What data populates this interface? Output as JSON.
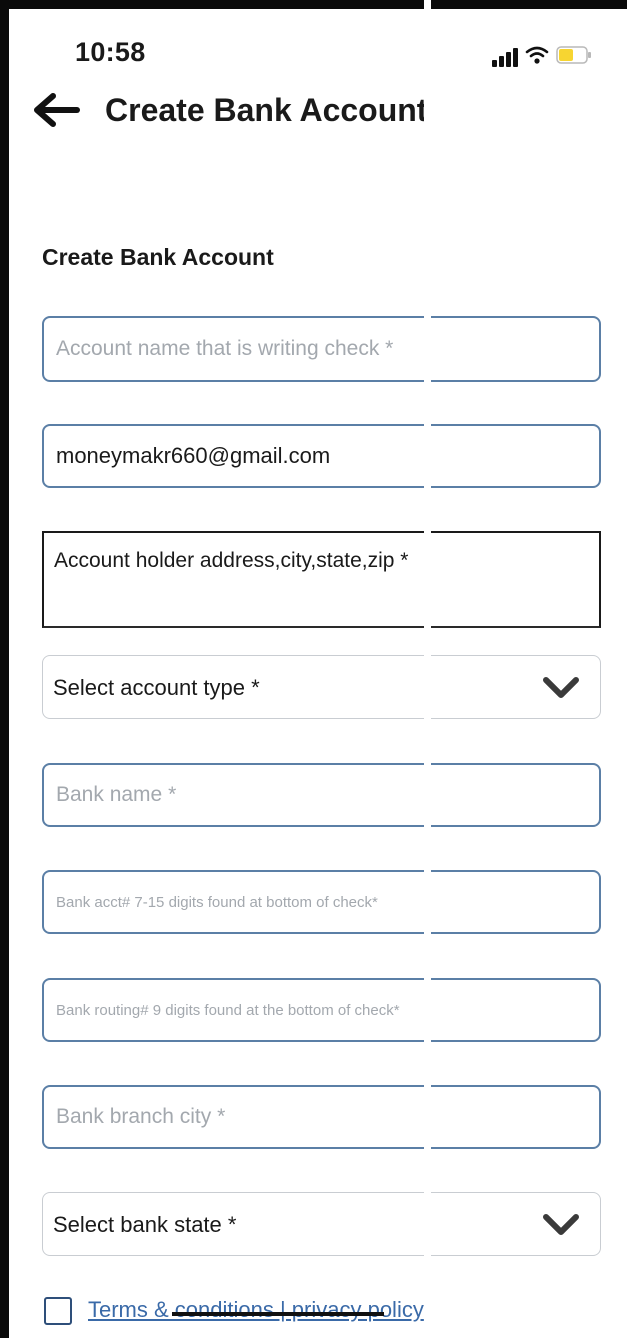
{
  "status_bar": {
    "time": "10:58",
    "icons": [
      "cellular-signal-icon",
      "wifi-icon",
      "battery-icon"
    ],
    "battery_color": "#f7d531"
  },
  "nav": {
    "back_icon": "arrow-left-icon",
    "title": "Create Bank Account"
  },
  "form": {
    "section_title": "Create Bank Account",
    "account_name": {
      "value": "",
      "placeholder": "Account name that is writing check *"
    },
    "email": {
      "value": "moneymakr660@gmail.com",
      "placeholder": ""
    },
    "address": {
      "value": "",
      "placeholder": "Account holder address,city,state,zip *"
    },
    "account_type": {
      "selected": "Select account type *",
      "icon": "chevron-down-icon"
    },
    "bank_name": {
      "value": "",
      "placeholder": "Bank name *"
    },
    "bank_account_number": {
      "value": "",
      "placeholder": "Bank acct# 7-15 digits found at bottom of check*"
    },
    "bank_routing_number": {
      "value": "",
      "placeholder": "Bank routing# 9 digits found at the bottom of check*"
    },
    "bank_branch_city": {
      "value": "",
      "placeholder": "Bank branch city *"
    },
    "bank_state": {
      "selected": "Select bank state *",
      "icon": "chevron-down-icon"
    },
    "terms": {
      "checked": false,
      "label": "Terms & conditions | privacy policy"
    }
  },
  "colors": {
    "input_border": "#5b7fa6",
    "select_border": "#c9cdd2",
    "link": "#3a6aa8",
    "text": "#1a1a1a",
    "placeholder": "#a3a8ae"
  }
}
